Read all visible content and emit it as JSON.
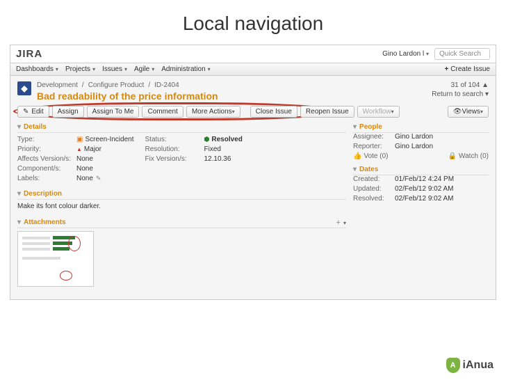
{
  "slide_title": "Local navigation",
  "logo": "JIRA",
  "user_name": "Gino Lardon l",
  "quicksearch_placeholder": "Quick Search",
  "nav": {
    "items": [
      "Dashboards",
      "Projects",
      "Issues",
      "Agile",
      "Administration"
    ],
    "create_issue": "Create Issue"
  },
  "breadcrumb": [
    "Development",
    "Configure Product",
    "ID-2404"
  ],
  "issue_title": "Bad readability of the price information",
  "nav_index": "31 of 104",
  "return_search": "Return to search",
  "toolbar": {
    "edit": "Edit",
    "assign": "Assign",
    "assign_to_me": "Assign To Me",
    "comment": "Comment",
    "more_actions": "More Actions",
    "close_issue": "Close Issue",
    "reopen_issue": "Reopen Issue",
    "workflow": "Workflow",
    "views": "Views"
  },
  "sections": {
    "details": "Details",
    "description": "Description",
    "attachments": "Attachments",
    "people": "People",
    "dates": "Dates"
  },
  "details": {
    "type_k": "Type:",
    "type_v": "Screen-Incident",
    "priority_k": "Priority:",
    "priority_v": "Major",
    "affects_k": "Affects Version/s:",
    "affects_v": "None",
    "components_k": "Component/s:",
    "components_v": "None",
    "labels_k": "Labels:",
    "labels_v": "None",
    "status_k": "Status:",
    "status_v": "Resolved",
    "resolution_k": "Resolution:",
    "resolution_v": "Fixed",
    "fixversion_k": "Fix Version/s:",
    "fixversion_v": "12.10.36"
  },
  "description": "Make its font colour darker.",
  "people": {
    "assignee_k": "Assignee:",
    "assignee_v": "Gino Lardon",
    "reporter_k": "Reporter:",
    "reporter_v": "Gino Lardon",
    "vote": "Vote (0)",
    "watch": "Watch (0)"
  },
  "dates": {
    "created_k": "Created:",
    "created_v": "01/Feb/12 4:24 PM",
    "updated_k": "Updated:",
    "updated_v": "02/Feb/12 9:02 AM",
    "resolved_k": "Resolved:",
    "resolved_v": "02/Feb/12 9:02 AM"
  },
  "footer_brand": "iAnua"
}
